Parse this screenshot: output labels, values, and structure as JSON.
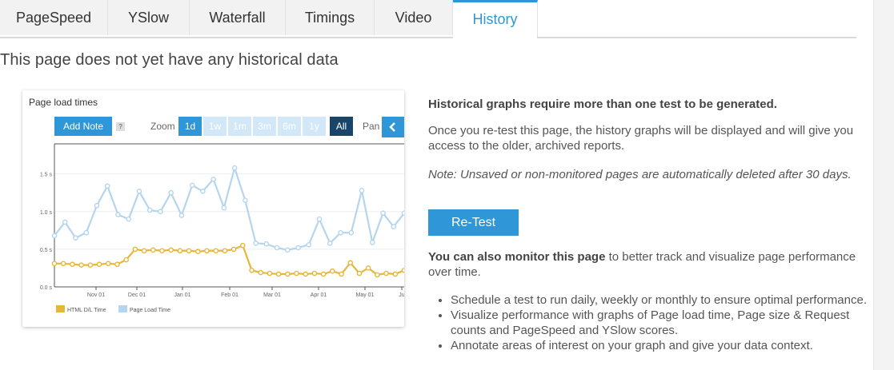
{
  "tabs": [
    {
      "label": "PageSpeed",
      "active": false
    },
    {
      "label": "YSlow",
      "active": false
    },
    {
      "label": "Waterfall",
      "active": false
    },
    {
      "label": "Timings",
      "active": false
    },
    {
      "label": "Video",
      "active": false
    },
    {
      "label": "History",
      "active": true
    }
  ],
  "page_title": "This page does not yet have any historical data",
  "chart": {
    "title": "Page load times",
    "add_note_label": "Add Note",
    "help_label": "?",
    "zoom_label": "Zoom",
    "zoom_options": [
      "1d",
      "1w",
      "1m",
      "3m",
      "6m",
      "1y",
      "All"
    ],
    "zoom_selected": "All",
    "pan_label": "Pan",
    "pan_icon": "chevron-left-icon"
  },
  "chart_data": {
    "type": "line",
    "title": "Page load times",
    "xlabel": "",
    "ylabel": "",
    "ylim": [
      0,
      1.9
    ],
    "y_ticks": [
      "0.0 s",
      "0.5 s",
      "1.0 s",
      "1.5 s"
    ],
    "x_ticks": [
      "Nov 01",
      "Dec 01",
      "Jan 01",
      "Feb 01",
      "Mar 01",
      "Apr 01",
      "May 01",
      "Ju"
    ],
    "grid": true,
    "legend_position": "bottom-left",
    "series": [
      {
        "name": "HTML D/L Time",
        "color": "#e7b73a",
        "values": [
          0.31,
          0.31,
          0.3,
          0.29,
          0.29,
          0.3,
          0.31,
          0.3,
          0.36,
          0.5,
          0.48,
          0.49,
          0.48,
          0.49,
          0.48,
          0.48,
          0.47,
          0.48,
          0.48,
          0.48,
          0.5,
          0.55,
          0.22,
          0.19,
          0.18,
          0.17,
          0.17,
          0.18,
          0.17,
          0.18,
          0.17,
          0.21,
          0.17,
          0.32,
          0.18,
          0.25,
          0.16,
          0.18,
          0.17,
          0.22
        ]
      },
      {
        "name": "Page Load Time",
        "color": "#b5d5ef",
        "values": [
          0.68,
          0.86,
          0.65,
          0.72,
          1.08,
          1.34,
          0.96,
          0.9,
          1.27,
          1.02,
          1.0,
          1.25,
          0.95,
          1.35,
          1.27,
          1.43,
          1.05,
          1.58,
          1.15,
          0.58,
          0.57,
          0.52,
          0.49,
          0.52,
          0.56,
          0.9,
          0.58,
          0.72,
          0.72,
          1.28,
          0.59,
          0.98,
          0.8,
          0.98
        ]
      }
    ],
    "axis_color": "#555555",
    "grid_color": "#eeeeee"
  },
  "info": {
    "heading": "Historical graphs require more than one test to be generated.",
    "paragraph1": "Once you re-test this page, the history graphs will be displayed and will give you access to the older, archived reports.",
    "note": "Note: Unsaved or non-monitored pages are automatically deleted after 30 days.",
    "retest_label": "Re-Test",
    "monitor_bold": "You can also monitor this page",
    "monitor_rest": " to better track and visualize page performance over time.",
    "bullets": [
      "Schedule a test to run daily, weekly or monthly to ensure optimal performance.",
      "Visualize performance with graphs of Page load time, Page size & Request counts and PageSpeed and YSlow scores.",
      "Annotate areas of interest on your graph and give your data context."
    ]
  },
  "colors": {
    "accent": "#2f96d7",
    "zoom_all": "#19456b",
    "zoom_inactive": "#d2e8f8"
  }
}
